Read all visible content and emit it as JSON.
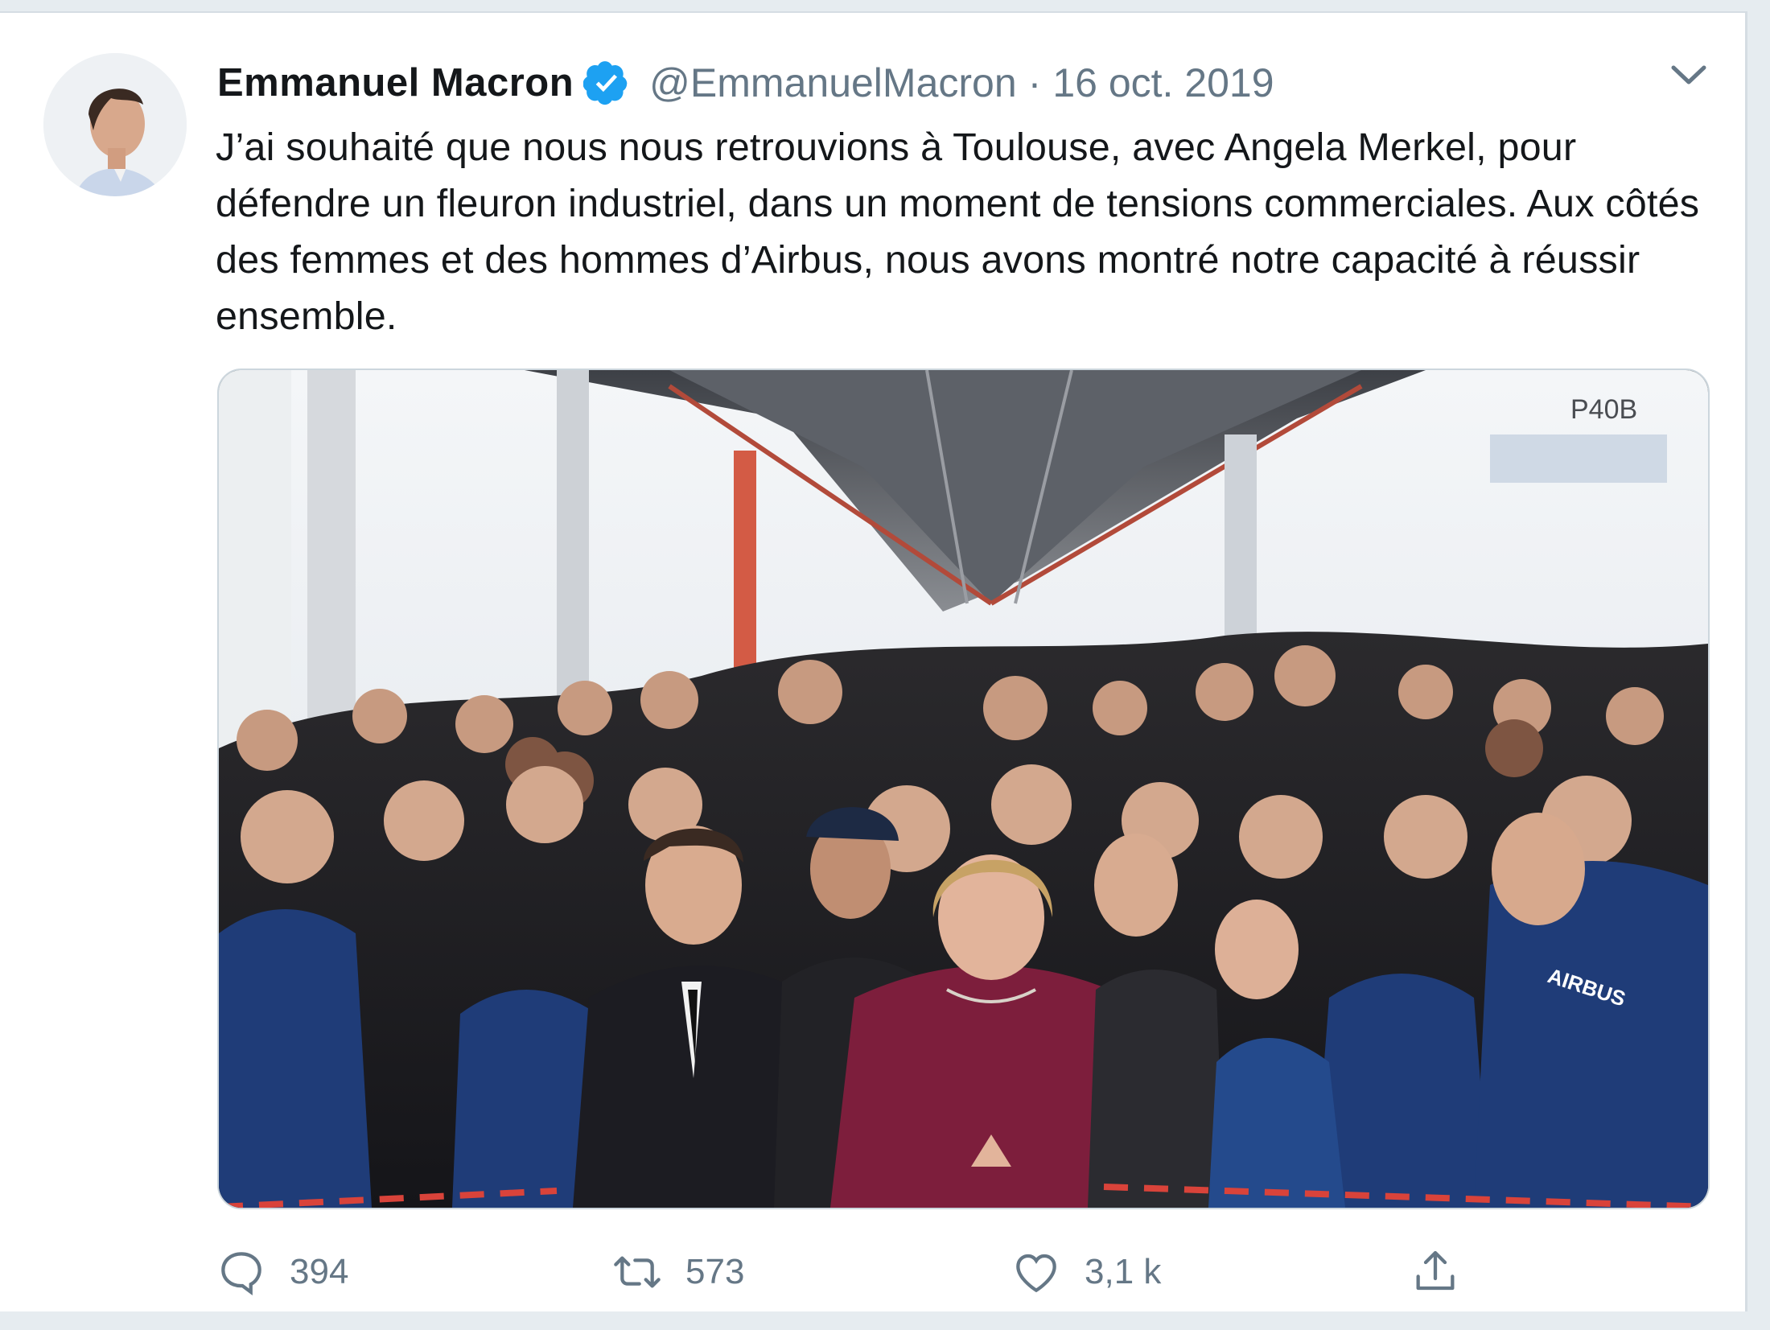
{
  "tweet": {
    "author_name": "Emmanuel Macron",
    "handle": "@EmmanuelMacron",
    "separator": "·",
    "date": "16 oct. 2019",
    "text": "J’ai souhaité que nous nous retrouvions à Toulouse, avec Angela Merkel, pour défendre un fleuron industriel, dans un moment de tensions commerciales. Aux côtés des femmes et des hommes d’Airbus, nous avons montré notre capacité à réussir ensemble.",
    "photo_sign": "P40B",
    "photo_logo": "AIRBUS"
  },
  "actions": {
    "replies": "394",
    "retweets": "573",
    "likes": "3,1 k"
  },
  "colors": {
    "verified": "#1da1f2",
    "text": "#14171a",
    "muted": "#657786",
    "background": "#e6ecf0"
  },
  "icons": [
    "verified-badge-icon",
    "chevron-down-icon",
    "reply-icon",
    "retweet-icon",
    "like-icon",
    "share-icon"
  ]
}
